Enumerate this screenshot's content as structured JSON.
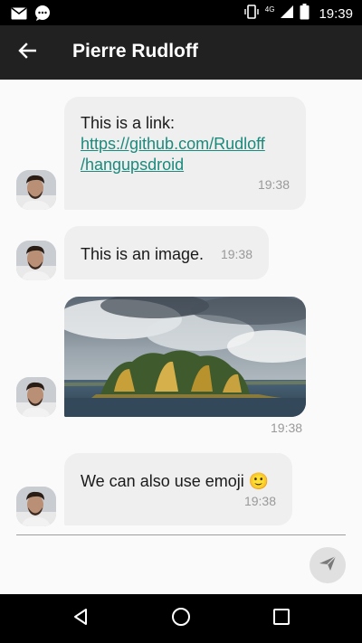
{
  "status_bar": {
    "time": "19:39",
    "network_label": "4G",
    "icons": [
      "mail-icon",
      "chat-notification-icon",
      "vibrate-icon",
      "signal-icon",
      "battery-icon"
    ]
  },
  "toolbar": {
    "title": "Pierre Rudloff",
    "back_icon": "arrow-back-icon"
  },
  "messages": [
    {
      "type": "link",
      "text": "This is a link:",
      "link_line1": "https://github.com/Rudloff",
      "link_line2": "/hangupsdroid",
      "time": "19:38"
    },
    {
      "type": "text",
      "text": "This is an image.",
      "time": "19:38"
    },
    {
      "type": "image",
      "alt": "lake island photo",
      "time": "19:38"
    },
    {
      "type": "text",
      "text": "We can also use emoji 🙂",
      "time": "19:38"
    }
  ],
  "input": {
    "placeholder": "",
    "send_icon": "send-icon"
  },
  "nav": {
    "icons": [
      "nav-back-icon",
      "nav-home-icon",
      "nav-recents-icon"
    ]
  },
  "colors": {
    "toolbar": "#212121",
    "bubble": "#efefef",
    "link": "#1b8a7c",
    "background": "#fafafa"
  }
}
